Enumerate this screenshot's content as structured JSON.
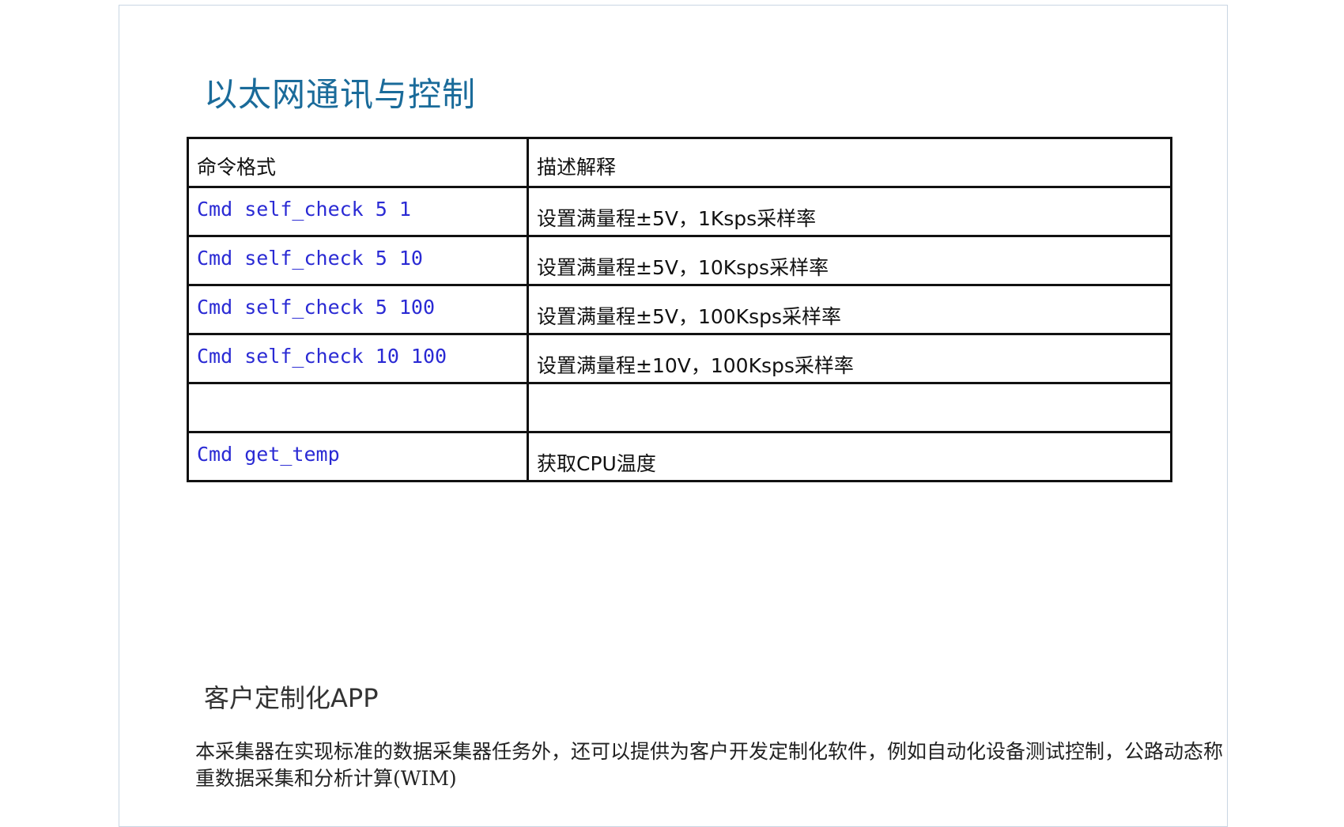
{
  "title": "以太网通讯与控制",
  "table": {
    "headers": [
      "命令格式",
      "描述解释"
    ],
    "rows": [
      {
        "command": "Cmd self_check 5 1",
        "description": "设置满量程±5V，1Ksps采样率"
      },
      {
        "command": "Cmd self_check 5 10",
        "description": "设置满量程±5V，10Ksps采样率"
      },
      {
        "command": "Cmd self_check 5 100",
        "description": "设置满量程±5V，100Ksps采样率"
      },
      {
        "command": "Cmd self_check 10 100",
        "description": "设置满量程±10V，100Ksps采样率"
      },
      {
        "command": "",
        "description": ""
      },
      {
        "command": "Cmd get_temp",
        "description": "获取CPU温度"
      }
    ]
  },
  "section2": {
    "title": "客户定制化APP",
    "paragraph": "本采集器在实现标准的数据采集器任务外，还可以提供为客户开发定制化软件，例如自动化设备测试控制，公路动态称重数据采集和分析计算(WIM)"
  },
  "colors": {
    "title": "#1a6b9a",
    "command": "#2a2ad4",
    "border": "#111111"
  }
}
